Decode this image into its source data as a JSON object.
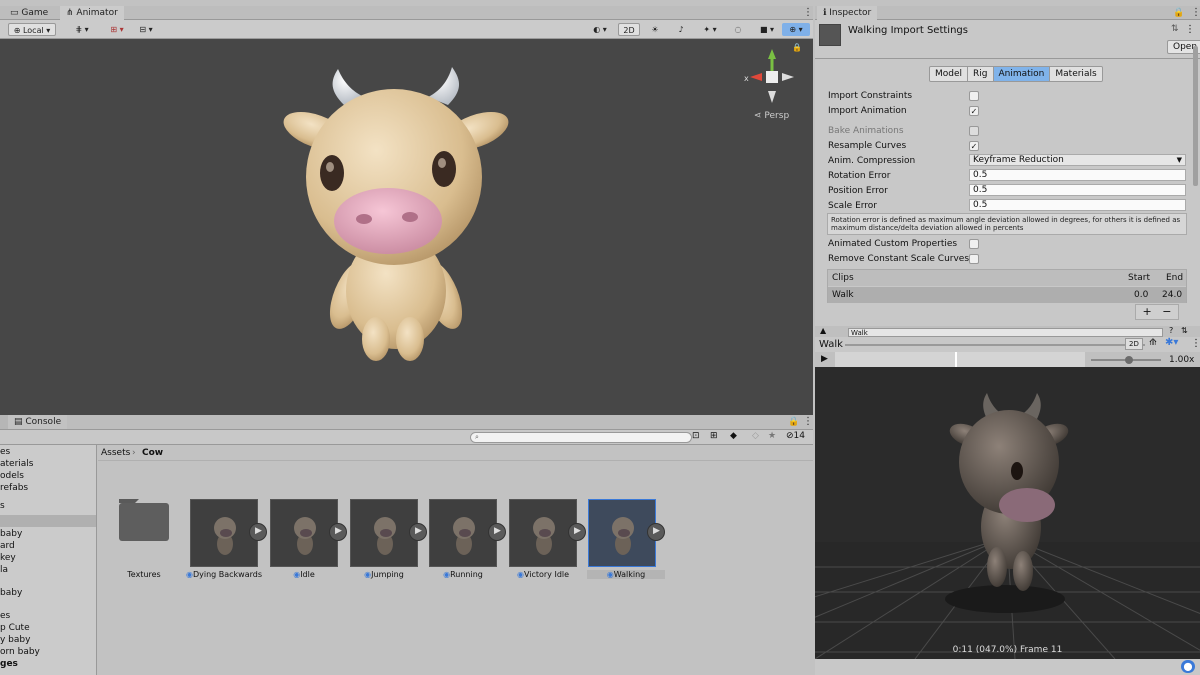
{
  "scene": {
    "tabs": [
      "Game",
      "Animator"
    ],
    "handle_mode": "Local",
    "toggle_2d": "2D",
    "projection": "Persp"
  },
  "inspector": {
    "tab": "Inspector",
    "title": "Walking Import Settings",
    "open_button": "Open",
    "subtabs": [
      "Model",
      "Rig",
      "Animation",
      "Materials"
    ],
    "active_subtab": "Animation",
    "import_constraints": {
      "label": "Import Constraints",
      "checked": false
    },
    "import_animation": {
      "label": "Import Animation",
      "checked": true
    },
    "bake_animations": {
      "label": "Bake Animations",
      "checked": false
    },
    "resample_curves": {
      "label": "Resample Curves",
      "checked": true
    },
    "anim_compression": {
      "label": "Anim. Compression",
      "value": "Keyframe Reduction"
    },
    "rotation_error": {
      "label": "Rotation Error",
      "value": "0.5"
    },
    "position_error": {
      "label": "Position Error",
      "value": "0.5"
    },
    "scale_error": {
      "label": "Scale Error",
      "value": "0.5"
    },
    "help_text": "Rotation error is defined as maximum angle deviation allowed in degrees, for others it is defined as maximum distance/delta deviation allowed in percents",
    "animated_custom_properties": {
      "label": "Animated Custom Properties",
      "checked": false
    },
    "remove_constant_scale": {
      "label": "Remove Constant Scale Curves",
      "checked": false
    },
    "clips": {
      "header": "Clips",
      "start_col": "Start",
      "end_col": "End",
      "rows": [
        {
          "name": "Walk",
          "start": "0.0",
          "end": "24.0"
        }
      ]
    },
    "add_label": "+",
    "remove_label": "−",
    "clip_name": "Walk"
  },
  "preview": {
    "title": "Walk",
    "toggle_2d": "2D",
    "speed": "1.00x",
    "status": "0:11 (047.0%) Frame 11"
  },
  "bottom": {
    "tab": "Console",
    "badge_count": "14",
    "breadcrumb": [
      "Assets",
      "Cow"
    ],
    "tree": [
      "es",
      "aterials",
      "odels",
      "refabs",
      "s",
      "",
      "baby",
      "ard",
      "key",
      "la",
      "",
      "baby",
      "",
      "es",
      "p Cute",
      "y baby",
      "orn baby",
      "ges"
    ],
    "folder": "Textures",
    "assets": [
      "Dying Backwards",
      "Idle",
      "Jumping",
      "Running",
      "Victory Idle",
      "Walking"
    ],
    "selected_asset": "Walking"
  },
  "colors": {
    "accent": "#3a79d8",
    "viewport_bg": "#474747",
    "selected": "#3e4a5c"
  }
}
